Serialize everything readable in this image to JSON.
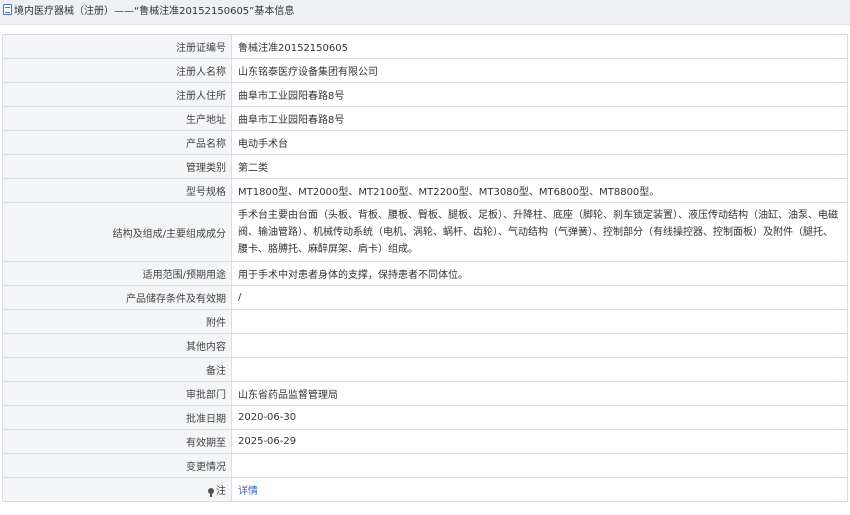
{
  "header": {
    "category": "境内医疗器械（注册）",
    "separator": "——",
    "title": "“鲁械注准20152150605”基本信息"
  },
  "rows": [
    {
      "label": "注册证编号",
      "value": "鲁械注准20152150605"
    },
    {
      "label": "注册人名称",
      "value": "山东铭泰医疗设备集团有限公司"
    },
    {
      "label": "注册人住所",
      "value": "曲阜市工业园阳春路8号"
    },
    {
      "label": "生产地址",
      "value": "曲阜市工业园阳春路8号"
    },
    {
      "label": "产品名称",
      "value": "电动手术台"
    },
    {
      "label": "管理类别",
      "value": "第二类"
    },
    {
      "label": "型号规格",
      "value": "MT1800型、MT2000型、MT2100型、MT2200型、MT3080型、MT6800型、MT8800型。"
    },
    {
      "label": "结构及组成/主要组成成分",
      "value": "手术台主要由台面（头板、背板、腰板、臀板、腿板、足板）、升降柱、底座（脚轮、刹车锁定装置）、液压传动结构（油缸、油泵、电磁阀、输油管路）、机械传动系统（电机、涡轮、蜗杆、齿轮）、气动结构（气弹簧）、控制部分（有线操控器、控制面板）及附件（腿托、腰卡、胳膊托、麻醉屏架、肩卡）组成。"
    },
    {
      "label": "适用范围/预期用途",
      "value": "用于手术中对患者身体的支撑，保持患者不同体位。"
    },
    {
      "label": "产品储存条件及有效期",
      "value": "/"
    },
    {
      "label": "附件",
      "value": ""
    },
    {
      "label": "其他内容",
      "value": ""
    },
    {
      "label": "备注",
      "value": ""
    },
    {
      "label": "审批部门",
      "value": "山东省药品监督管理局"
    },
    {
      "label": "批准日期",
      "value": "2020-06-30"
    },
    {
      "label": "有效期至",
      "value": "2025-06-29"
    },
    {
      "label": "变更情况",
      "value": ""
    }
  ],
  "note": {
    "label": "注",
    "link": "详情",
    "icon": "pin-icon"
  }
}
